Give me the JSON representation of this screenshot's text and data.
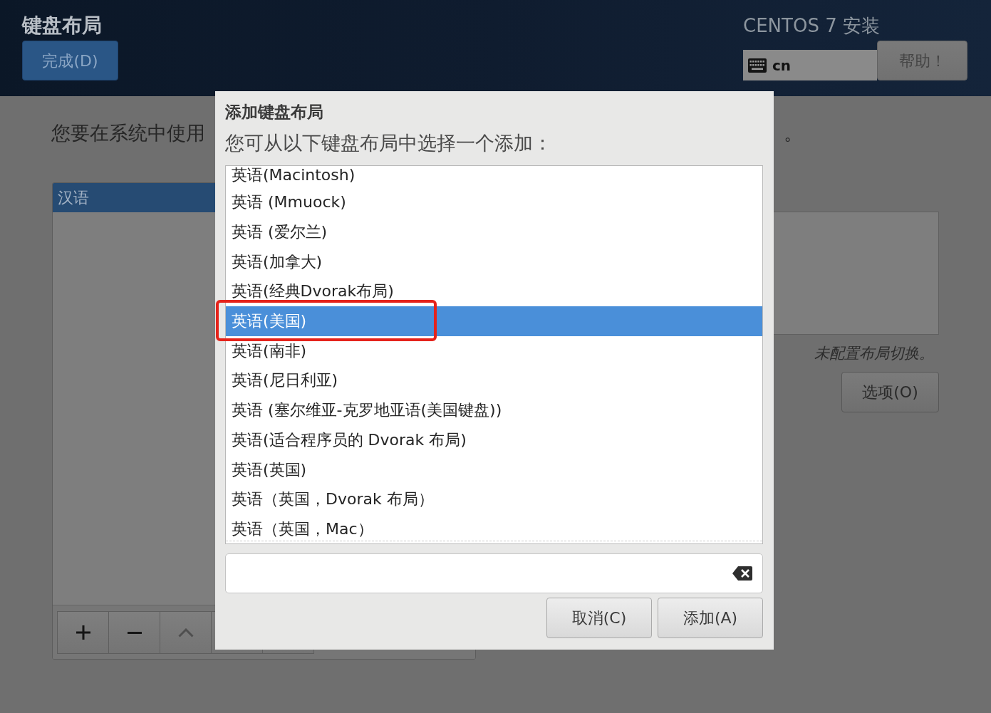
{
  "header": {
    "title": "键盘布局",
    "done_button": "完成(D)",
    "product": "CENTOS 7 安装",
    "keyboard_indicator": "cn",
    "help_button": "帮助！"
  },
  "background": {
    "prompt_start": "您要在系统中使用",
    "prompt_end": "。",
    "layouts": [
      {
        "label": "汉语",
        "selected": true
      }
    ],
    "switch_status": "未配置布局切换。",
    "options_button": "选项(O)"
  },
  "dialog": {
    "title": "添加键盘布局",
    "instruction": "您可从以下键盘布局中选择一个添加：",
    "layouts": [
      {
        "label": "英语(Macintosh)",
        "selected": false,
        "annotation_box": false
      },
      {
        "label": "英语 (Mmuock)",
        "selected": false,
        "annotation_box": false
      },
      {
        "label": "英语 (爱尔兰)",
        "selected": false,
        "annotation_box": false
      },
      {
        "label": "英语(加拿大)",
        "selected": false,
        "annotation_box": false
      },
      {
        "label": "英语(经典Dvorak布局)",
        "selected": false,
        "annotation_box": false
      },
      {
        "label": "英语(美国)",
        "selected": true,
        "annotation_box": true
      },
      {
        "label": "英语(南非)",
        "selected": false,
        "annotation_box": false
      },
      {
        "label": "英语(尼日利亚)",
        "selected": false,
        "annotation_box": false
      },
      {
        "label": "英语 (塞尔维亚-克罗地亚语(美国键盘))",
        "selected": false,
        "annotation_box": false
      },
      {
        "label": "英语(适合程序员的 Dvorak 布局)",
        "selected": false,
        "annotation_box": false
      },
      {
        "label": "英语(英国)",
        "selected": false,
        "annotation_box": false
      },
      {
        "label": "英语（英国，Dvorak 布局）",
        "selected": false,
        "annotation_box": false
      },
      {
        "label": "英语（英国，Mac）",
        "selected": false,
        "annotation_box": false
      }
    ],
    "buttons": [
      "取消(C)",
      "添加(A)"
    ]
  }
}
